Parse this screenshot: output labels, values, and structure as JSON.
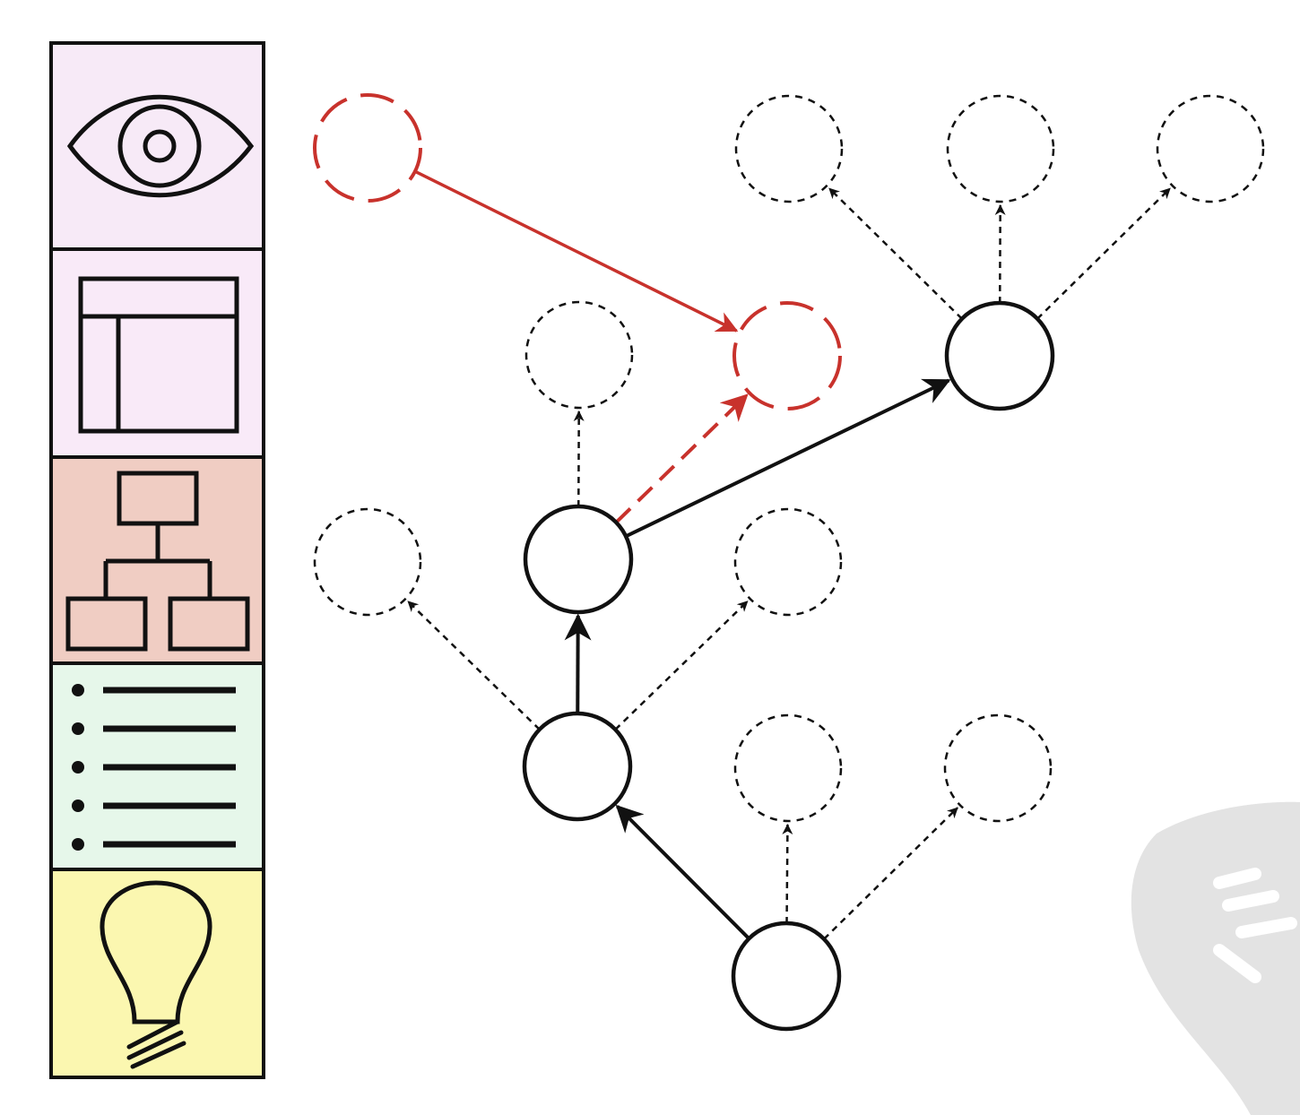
{
  "colors": {
    "ink": "#111111",
    "accent": "#c8322c",
    "watermark": "#e2e2e2",
    "panel_observe": "#f7eaf7",
    "panel_layout": "#f9eaf8",
    "panel_hierarchy": "#f0cdc3",
    "panel_list": "#e6f7ea",
    "panel_idea": "#fbf7b0"
  },
  "sidebar": {
    "panels": [
      {
        "icon": "eye-icon"
      },
      {
        "icon": "layout-icon"
      },
      {
        "icon": "hierarchy-icon"
      },
      {
        "icon": "list-icon"
      },
      {
        "icon": "lightbulb-icon"
      }
    ]
  },
  "tree": {
    "nodes": [
      {
        "id": "n-root",
        "state": "visited"
      },
      {
        "id": "n-mid",
        "state": "visited"
      },
      {
        "id": "n-upper",
        "state": "visited"
      },
      {
        "id": "n-top",
        "state": "visited"
      },
      {
        "id": "c-mid-left",
        "state": "candidate"
      },
      {
        "id": "c-mid-right",
        "state": "candidate"
      },
      {
        "id": "c-upper-top",
        "state": "candidate"
      },
      {
        "id": "c-root-mid",
        "state": "candidate"
      },
      {
        "id": "c-root-right",
        "state": "candidate"
      },
      {
        "id": "c-top-left",
        "state": "candidate"
      },
      {
        "id": "c-top-center",
        "state": "candidate"
      },
      {
        "id": "c-top-right",
        "state": "candidate"
      },
      {
        "id": "h-target",
        "state": "highlight"
      },
      {
        "id": "h-source",
        "state": "highlight"
      }
    ],
    "edges": [
      {
        "from": "n-root",
        "to": "n-mid",
        "style": "path"
      },
      {
        "from": "n-mid",
        "to": "n-upper",
        "style": "path"
      },
      {
        "from": "n-upper",
        "to": "n-top",
        "style": "path"
      },
      {
        "from": "n-root",
        "to": "c-root-mid",
        "style": "candidate"
      },
      {
        "from": "n-root",
        "to": "c-root-right",
        "style": "candidate"
      },
      {
        "from": "n-mid",
        "to": "c-mid-left",
        "style": "candidate"
      },
      {
        "from": "n-mid",
        "to": "c-mid-right",
        "style": "candidate"
      },
      {
        "from": "n-upper",
        "to": "c-upper-top",
        "style": "candidate"
      },
      {
        "from": "n-upper",
        "to": "h-target",
        "style": "highlight-candidate"
      },
      {
        "from": "n-top",
        "to": "c-top-left",
        "style": "candidate"
      },
      {
        "from": "n-top",
        "to": "c-top-center",
        "style": "candidate"
      },
      {
        "from": "n-top",
        "to": "c-top-right",
        "style": "candidate"
      },
      {
        "from": "h-source",
        "to": "h-target",
        "style": "highlight-jump"
      }
    ]
  }
}
